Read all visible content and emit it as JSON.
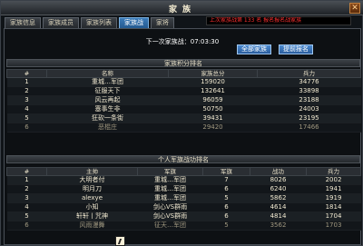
{
  "window": {
    "title": "家族",
    "close_label": "✕"
  },
  "tabs": [
    {
      "label": "家族信息",
      "active": false
    },
    {
      "label": "家族成员",
      "active": false
    },
    {
      "label": "家族列表",
      "active": false
    },
    {
      "label": "家族战",
      "active": true
    },
    {
      "label": "家将",
      "active": false
    }
  ],
  "ticker": "上次家族战第 133 名 报名报名战家族",
  "countdown": "下一次家族战：07:03:30",
  "buttons": {
    "all_families": "全部家族",
    "early_signup": "提前报名"
  },
  "ranking": {
    "title": "家族积分排名",
    "headers": [
      "#",
      "名称",
      "家族总分",
      "兵力"
    ],
    "rows": [
      [
        "1",
        "重城…军团",
        "159020",
        "34776"
      ],
      [
        "2",
        "征服天下",
        "132641",
        "33898"
      ],
      [
        "3",
        "风云再起",
        "96059",
        "23188"
      ],
      [
        "4",
        "塞事生非",
        "50750",
        "24003"
      ],
      [
        "5",
        "狂砍一条街",
        "39431",
        "23195"
      ],
      [
        "6",
        "恶棍庄",
        "29420",
        "17466"
      ]
    ]
  },
  "personal": {
    "title": "个人军旗战功排名",
    "headers": [
      "#",
      "主帅",
      "军旗",
      "军旗",
      "战功",
      "兵力"
    ],
    "rows": [
      [
        "1",
        "大明者付",
        "重城…军团",
        "7",
        "8026",
        "2002"
      ],
      [
        "2",
        "明月刀",
        "重城…军团",
        "6",
        "6240",
        "1941"
      ],
      [
        "3",
        "alexye",
        "重城…军团",
        "5",
        "5862",
        "1919"
      ],
      [
        "4",
        "小知",
        "剑心VS群雨",
        "6",
        "4614",
        "1814"
      ],
      [
        "5",
        "轩轩丨咒神",
        "剑心VS群雨",
        "6",
        "4814",
        "1704"
      ],
      [
        "6",
        "风雨漫舞",
        "征天…军团",
        "5",
        "3562",
        "1703"
      ]
    ]
  }
}
